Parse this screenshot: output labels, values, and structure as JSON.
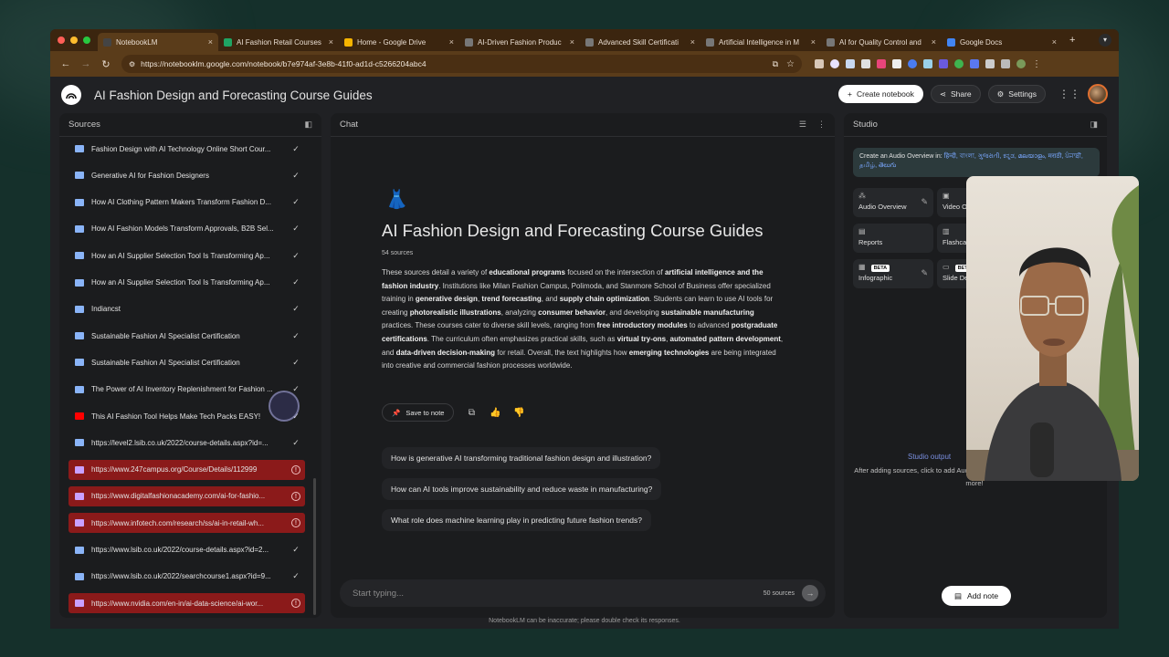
{
  "browser": {
    "tabs": [
      {
        "label": "NotebookLM",
        "icon": "notebooklm-icon",
        "active": true
      },
      {
        "label": "AI Fashion Retail Courses",
        "icon": "sheets-icon"
      },
      {
        "label": "Home - Google Drive",
        "icon": "drive-icon"
      },
      {
        "label": "AI-Driven Fashion Produc",
        "icon": "site-icon"
      },
      {
        "label": "Advanced Skill Certificati",
        "icon": "site-icon"
      },
      {
        "label": "Artificial Intelligence in M",
        "icon": "site-icon"
      },
      {
        "label": "AI for Quality Control and",
        "icon": "site-icon"
      },
      {
        "label": "Google Docs",
        "icon": "docs-icon"
      }
    ],
    "close_glyph": "×",
    "new_tab_glyph": "+",
    "url": "https://notebooklm.google.com/notebook/b7e974af-3e8b-41f0-ad1d-c5266204abc4"
  },
  "app": {
    "title": "AI Fashion Design and Forecasting Course Guides",
    "create_notebook": "Create notebook",
    "share": "Share",
    "settings": "Settings"
  },
  "sources": {
    "heading": "Sources",
    "items": [
      {
        "label": "Fashion Design with AI Technology Online Short Cour...",
        "status": "ok",
        "kind": "web"
      },
      {
        "label": "Generative AI for Fashion Designers",
        "status": "ok",
        "kind": "web"
      },
      {
        "label": "How AI Clothing Pattern Makers Transform Fashion D...",
        "status": "ok",
        "kind": "web"
      },
      {
        "label": "How AI Fashion Models Transform Approvals, B2B Sel...",
        "status": "ok",
        "kind": "web"
      },
      {
        "label": "How an AI Supplier Selection Tool Is Transforming Ap...",
        "status": "ok",
        "kind": "web"
      },
      {
        "label": "How an AI Supplier Selection Tool Is Transforming Ap...",
        "status": "ok",
        "kind": "web"
      },
      {
        "label": "Indiancst",
        "status": "ok",
        "kind": "web"
      },
      {
        "label": "Sustainable Fashion AI Specialist Certification",
        "status": "ok",
        "kind": "web"
      },
      {
        "label": "Sustainable Fashion AI Specialist Certification",
        "status": "ok",
        "kind": "web"
      },
      {
        "label": "The Power of AI Inventory Replenishment for Fashion ...",
        "status": "ok",
        "kind": "web"
      },
      {
        "label": "This AI Fashion Tool Helps Make Tech Packs EASY!",
        "status": "ok",
        "kind": "youtube"
      },
      {
        "label": "https://level2.lsib.co.uk/2022/course-details.aspx?id=...",
        "status": "ok",
        "kind": "web"
      },
      {
        "label": "https://www.247campus.org/Course/Details/112999",
        "status": "error",
        "kind": "web"
      },
      {
        "label": "https://www.digitalfashionacademy.com/ai-for-fashio...",
        "status": "error",
        "kind": "web"
      },
      {
        "label": "https://www.infotech.com/research/ss/ai-in-retail-wh...",
        "status": "error",
        "kind": "web"
      },
      {
        "label": "https://www.lsib.co.uk/2022/course-details.aspx?id=2...",
        "status": "ok",
        "kind": "web"
      },
      {
        "label": "https://www.lsib.co.uk/2022/searchcourse1.aspx?id=9...",
        "status": "ok",
        "kind": "web"
      },
      {
        "label": "https://www.nvidia.com/en-in/ai-data-science/ai-wor...",
        "status": "error",
        "kind": "web"
      }
    ]
  },
  "chat": {
    "heading": "Chat",
    "emoji": "👗",
    "title": "AI Fashion Design and Forecasting Course Guides",
    "source_count": "54 sources",
    "summary_segments": [
      {
        "t": "These sources detail a variety of ",
        "b": false
      },
      {
        "t": "educational programs",
        "b": true
      },
      {
        "t": " focused on the intersection of ",
        "b": false
      },
      {
        "t": "artificial intelligence and the fashion industry",
        "b": true
      },
      {
        "t": ". Institutions like Milan Fashion Campus, Polimoda, and Stanmore School of Business offer specialized training in ",
        "b": false
      },
      {
        "t": "generative design",
        "b": true
      },
      {
        "t": ", ",
        "b": false
      },
      {
        "t": "trend forecasting",
        "b": true
      },
      {
        "t": ", and ",
        "b": false
      },
      {
        "t": "supply chain optimization",
        "b": true
      },
      {
        "t": ". Students can learn to use AI tools for creating ",
        "b": false
      },
      {
        "t": "photorealistic illustrations",
        "b": true
      },
      {
        "t": ", analyzing ",
        "b": false
      },
      {
        "t": "consumer behavior",
        "b": true
      },
      {
        "t": ", and developing ",
        "b": false
      },
      {
        "t": "sustainable manufacturing",
        "b": true
      },
      {
        "t": " practices. These courses cater to diverse skill levels, ranging from ",
        "b": false
      },
      {
        "t": "free introductory modules",
        "b": true
      },
      {
        "t": " to advanced ",
        "b": false
      },
      {
        "t": "postgraduate certifications",
        "b": true
      },
      {
        "t": ". The curriculum often emphasizes practical skills, such as ",
        "b": false
      },
      {
        "t": "virtual try-ons",
        "b": true
      },
      {
        "t": ", ",
        "b": false
      },
      {
        "t": "automated pattern development",
        "b": true
      },
      {
        "t": ", and ",
        "b": false
      },
      {
        "t": "data-driven decision-making",
        "b": true
      },
      {
        "t": " for retail. Overall, the text highlights how ",
        "b": false
      },
      {
        "t": "emerging technologies",
        "b": true
      },
      {
        "t": " are being integrated into creative and commercial fashion processes worldwide.",
        "b": false
      }
    ],
    "save_to_note": "Save to note",
    "suggestions": [
      "How is generative AI transforming traditional fashion design and illustration?",
      "How can AI tools improve sustainability and reduce waste in manufacturing?",
      "What role does machine learning play in predicting future fashion trends?"
    ],
    "input_placeholder": "Start typing...",
    "input_source_count": "50 sources",
    "disclaimer": "NotebookLM can be inaccurate; please double check its responses."
  },
  "studio": {
    "heading": "Studio",
    "audio_banner_prefix": "Create an Audio Overview in:",
    "audio_languages": "हिन्दी, বাংলা, ગુજરાતી, ಕನ್ನಡ, മലയാളം, मराठी, ਪੰਜਾਬੀ, தமிழ், తెలుగు",
    "cards": [
      {
        "label": "Audio Overview",
        "icon": "audio-waveform-icon",
        "editable": true
      },
      {
        "label": "Video Overview",
        "icon": "video-icon",
        "editable": false
      },
      {
        "label": "Reports",
        "icon": "reports-icon",
        "editable": false
      },
      {
        "label": "Flashcards",
        "icon": "flashcards-icon",
        "editable": false
      },
      {
        "label": "Infographic",
        "icon": "infographic-icon",
        "editable": true,
        "badge": "BETA"
      },
      {
        "label": "Slide Deck",
        "icon": "slides-icon",
        "editable": false,
        "badge": "BETA"
      }
    ],
    "output_title": "Studio output",
    "output_hint": "After adding sources, click to add Audio Overview, Study Guide, Mind Map, and more!",
    "add_note": "Add note"
  },
  "colors": {
    "accent": "#4ec3b5",
    "error_row": "#8b1a1a",
    "link": "#7aa8ff"
  }
}
